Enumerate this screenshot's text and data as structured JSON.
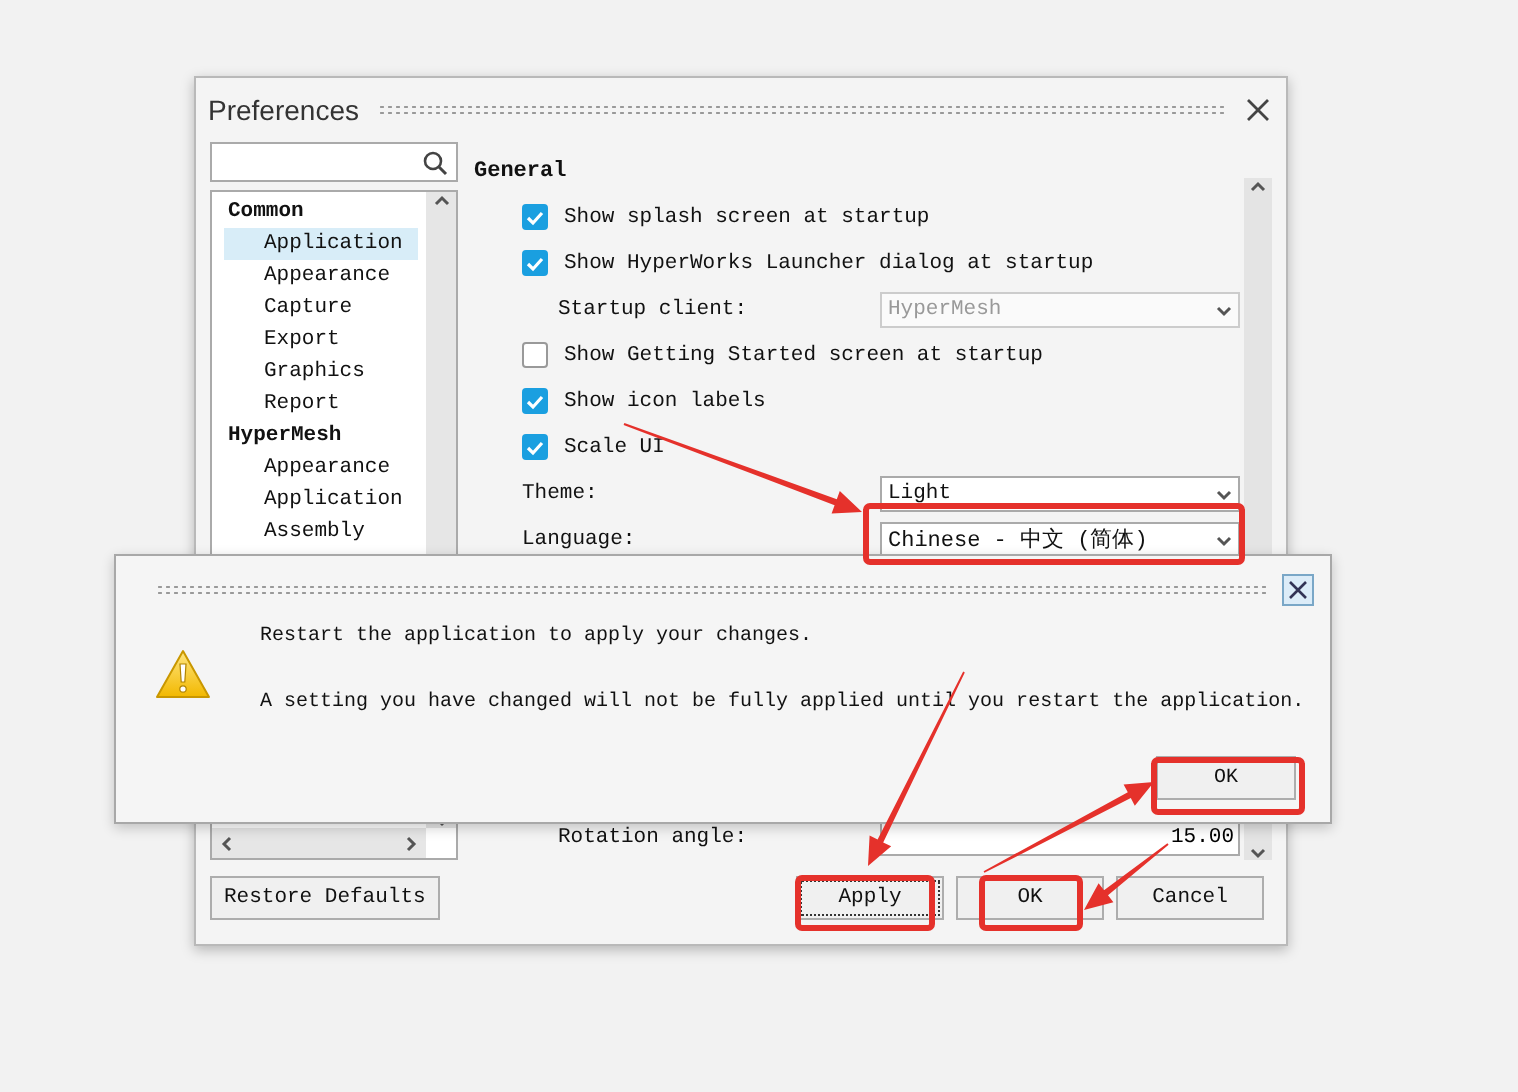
{
  "preferences": {
    "title": "Preferences",
    "tree": [
      {
        "label": "Common",
        "selected": false,
        "children": [
          {
            "label": "Application",
            "selected": true
          },
          {
            "label": "Appearance",
            "selected": false
          },
          {
            "label": "Capture",
            "selected": false
          },
          {
            "label": "Export",
            "selected": false
          },
          {
            "label": "Graphics",
            "selected": false
          },
          {
            "label": "Report",
            "selected": false
          }
        ]
      },
      {
        "label": "HyperMesh",
        "selected": false,
        "children": [
          {
            "label": "Appearance",
            "selected": false
          },
          {
            "label": "Application",
            "selected": false
          },
          {
            "label": "Assembly",
            "selected": false
          }
        ]
      }
    ],
    "section": "General",
    "settings": [
      {
        "kind": "checkbox",
        "label": "Show splash screen at startup",
        "checked": true
      },
      {
        "kind": "checkbox",
        "label": "Show HyperWorks Launcher dialog at startup",
        "checked": true
      },
      {
        "kind": "subselect",
        "label": "Startup client:",
        "value": "HyperMesh",
        "disabled": true
      },
      {
        "kind": "checkbox",
        "label": "Show Getting Started screen at startup",
        "checked": false
      },
      {
        "kind": "checkbox",
        "label": "Show icon labels",
        "checked": true
      },
      {
        "kind": "checkbox",
        "label": "Scale UI",
        "checked": true
      },
      {
        "kind": "select",
        "label": "Theme:",
        "value": "Light",
        "disabled": false
      },
      {
        "kind": "select",
        "label": "Language:",
        "value": "Chinese - 中文 (简体)",
        "disabled": false
      }
    ],
    "bottom_setting": {
      "kind": "number",
      "label": "Rotation angle:",
      "value": "15.00"
    },
    "restore_button": "Restore Defaults",
    "buttons": [
      {
        "label": "Apply",
        "focused": true
      },
      {
        "label": "OK",
        "focused": false
      },
      {
        "label": "Cancel",
        "focused": false
      }
    ]
  },
  "dialog": {
    "message": "Restart the application to apply your changes.",
    "detail": "A setting you have changed will not be fully applied until you restart the application.",
    "button": "OK"
  }
}
